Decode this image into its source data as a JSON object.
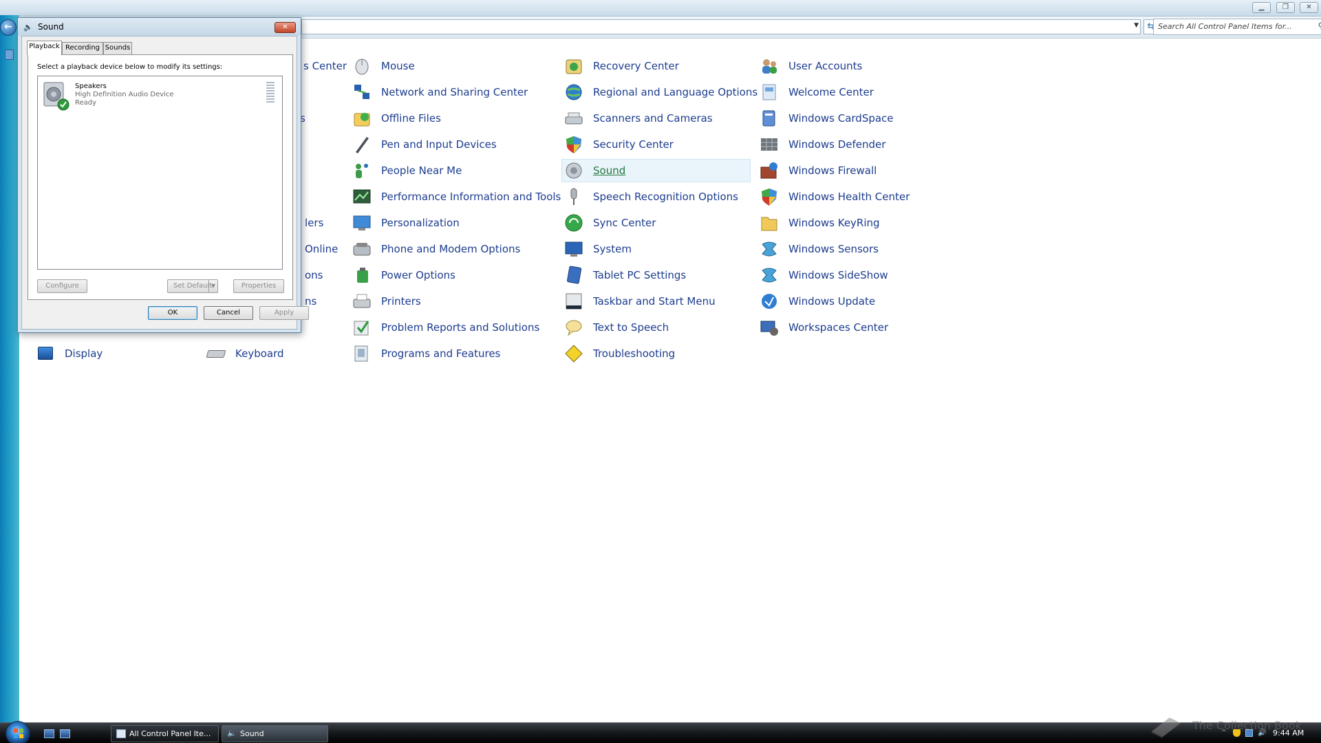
{
  "explorer": {
    "title_controls": [
      "minimize",
      "maximize",
      "close"
    ],
    "search_placeholder": "Search All Control Panel Items for...",
    "partial_labels": [
      "s Center",
      "s",
      "lers",
      "Online",
      "ons",
      "ns"
    ],
    "items_col1": [
      {
        "label": "Display",
        "icon": "display-icon"
      },
      {
        "label": "Keyboard",
        "icon": "keyboard-icon"
      }
    ],
    "items_col3": [
      {
        "label": "Mouse",
        "icon": "mouse-icon"
      },
      {
        "label": "Network and Sharing Center",
        "icon": "network-icon"
      },
      {
        "label": "Offline Files",
        "icon": "offline-files-icon"
      },
      {
        "label": "Pen and Input Devices",
        "icon": "pen-icon"
      },
      {
        "label": "People Near Me",
        "icon": "people-icon"
      },
      {
        "label": "Performance Information and Tools",
        "icon": "performance-icon"
      },
      {
        "label": "Personalization",
        "icon": "personalization-icon"
      },
      {
        "label": "Phone and Modem Options",
        "icon": "phone-icon"
      },
      {
        "label": "Power Options",
        "icon": "power-icon"
      },
      {
        "label": "Printers",
        "icon": "printer-icon"
      },
      {
        "label": "Problem Reports and Solutions",
        "icon": "problem-reports-icon"
      },
      {
        "label": "Programs and Features",
        "icon": "programs-icon"
      }
    ],
    "items_col4": [
      {
        "label": "Recovery Center",
        "icon": "recovery-icon"
      },
      {
        "label": "Regional and Language Options",
        "icon": "globe-icon"
      },
      {
        "label": "Scanners and Cameras",
        "icon": "scanner-icon"
      },
      {
        "label": "Security Center",
        "icon": "security-shield-icon"
      },
      {
        "label": "Sound",
        "icon": "speaker-icon"
      },
      {
        "label": "Speech Recognition Options",
        "icon": "microphone-icon"
      },
      {
        "label": "Sync Center",
        "icon": "sync-icon"
      },
      {
        "label": "System",
        "icon": "system-icon"
      },
      {
        "label": "Tablet PC Settings",
        "icon": "tablet-icon"
      },
      {
        "label": "Taskbar and Start Menu",
        "icon": "taskbar-icon"
      },
      {
        "label": "Text to Speech",
        "icon": "speech-bubble-icon"
      },
      {
        "label": "Troubleshooting",
        "icon": "troubleshooting-icon"
      }
    ],
    "items_col5": [
      {
        "label": "User Accounts",
        "icon": "users-icon"
      },
      {
        "label": "Welcome Center",
        "icon": "welcome-icon"
      },
      {
        "label": "Windows CardSpace",
        "icon": "cardspace-icon"
      },
      {
        "label": "Windows Defender",
        "icon": "defender-icon"
      },
      {
        "label": "Windows Firewall",
        "icon": "firewall-icon"
      },
      {
        "label": "Windows Health Center",
        "icon": "health-shield-icon"
      },
      {
        "label": "Windows KeyRing",
        "icon": "folder-icon"
      },
      {
        "label": "Windows Sensors",
        "icon": "sensors-icon"
      },
      {
        "label": "Windows SideShow",
        "icon": "sideshow-icon"
      },
      {
        "label": "Windows Update",
        "icon": "update-icon"
      },
      {
        "label": "Workspaces Center",
        "icon": "workspaces-icon"
      }
    ]
  },
  "dialog": {
    "title": "Sound",
    "tabs": [
      "Playback",
      "Recording",
      "Sounds"
    ],
    "active_tab": "Playback",
    "instruction": "Select a playback device below to modify its settings:",
    "device": {
      "name": "Speakers",
      "description": "High Definition Audio Device",
      "status": "Ready",
      "is_default": true
    },
    "buttons": {
      "configure": "Configure",
      "set_default": "Set Default",
      "properties": "Properties",
      "ok": "OK",
      "cancel": "Cancel",
      "apply": "Apply"
    }
  },
  "taskbar": {
    "tasks": [
      {
        "label": "All Control Panel Ite...",
        "active": false
      },
      {
        "label": "Sound",
        "active": true
      }
    ],
    "clock": "9:44 AM",
    "watermark": "The Collection Book"
  },
  "colors": {
    "link": "#1c3c8e",
    "hover_link": "#217a3d",
    "hover_bg": "#eaf4fb",
    "taskbar": "#15181b"
  }
}
